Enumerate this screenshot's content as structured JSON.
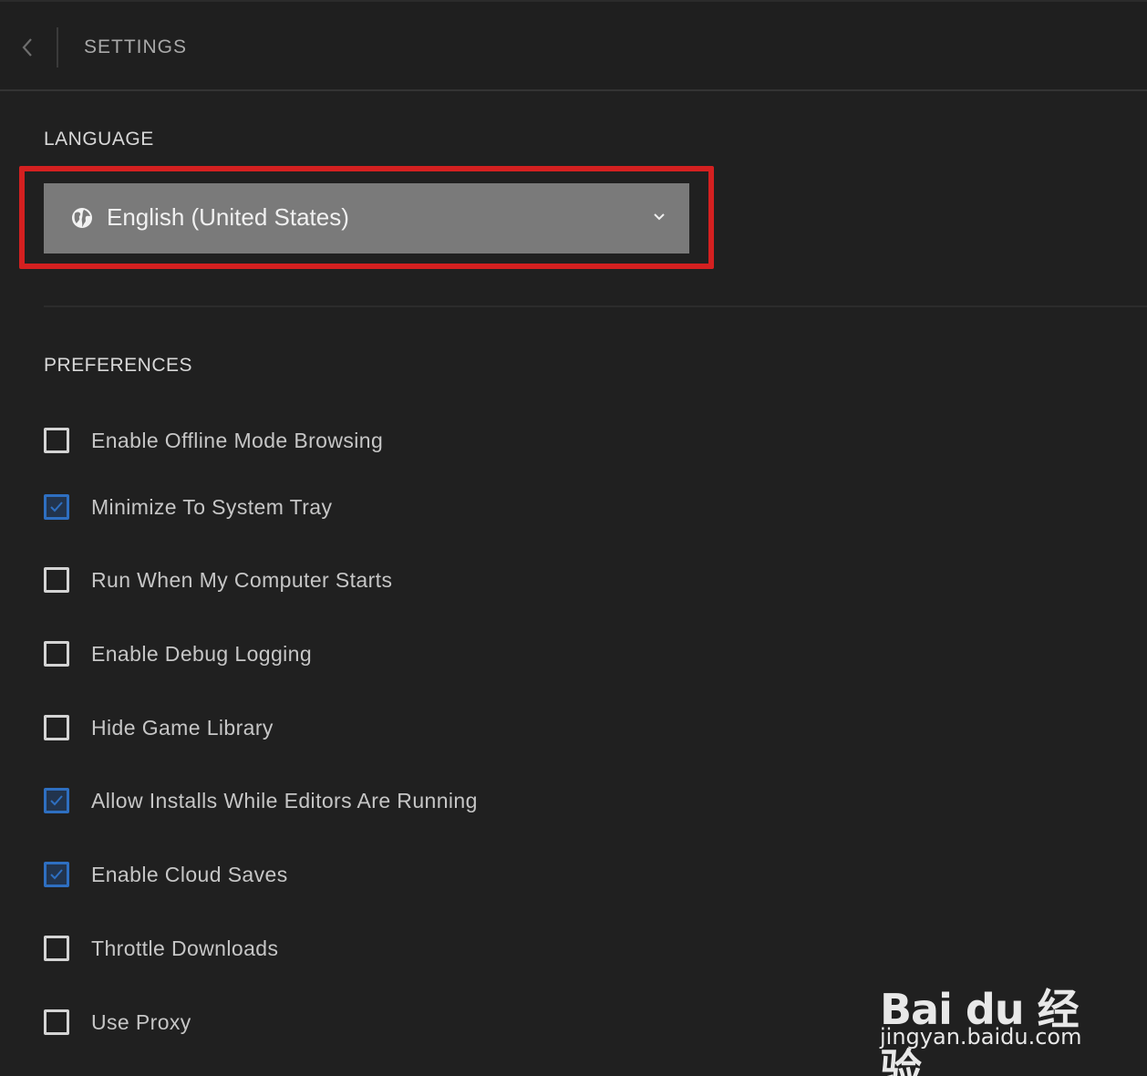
{
  "header": {
    "title": "SETTINGS"
  },
  "language": {
    "heading": "LANGUAGE",
    "selected": "English (United States)",
    "icon": "globe-icon",
    "highlight_color": "#d42020"
  },
  "preferences": {
    "heading": "PREFERENCES",
    "options": [
      {
        "label": "Enable Offline Mode Browsing",
        "checked": false
      },
      {
        "label": "Minimize To System Tray",
        "checked": true
      },
      {
        "label": "Run When My Computer Starts",
        "checked": false
      },
      {
        "label": "Enable Debug Logging",
        "checked": false
      },
      {
        "label": "Hide Game Library",
        "checked": false
      },
      {
        "label": "Allow Installs While Editors Are Running",
        "checked": true
      },
      {
        "label": "Enable Cloud Saves",
        "checked": true
      },
      {
        "label": "Throttle Downloads",
        "checked": false
      },
      {
        "label": "Use Proxy",
        "checked": false
      }
    ]
  },
  "watermark": {
    "logo": "Bai du 经验",
    "url": "jingyan.baidu.com"
  },
  "colors": {
    "background": "#202020",
    "checkbox_checked": "#2e6fc1",
    "dropdown_bg": "#7a7a7a"
  }
}
